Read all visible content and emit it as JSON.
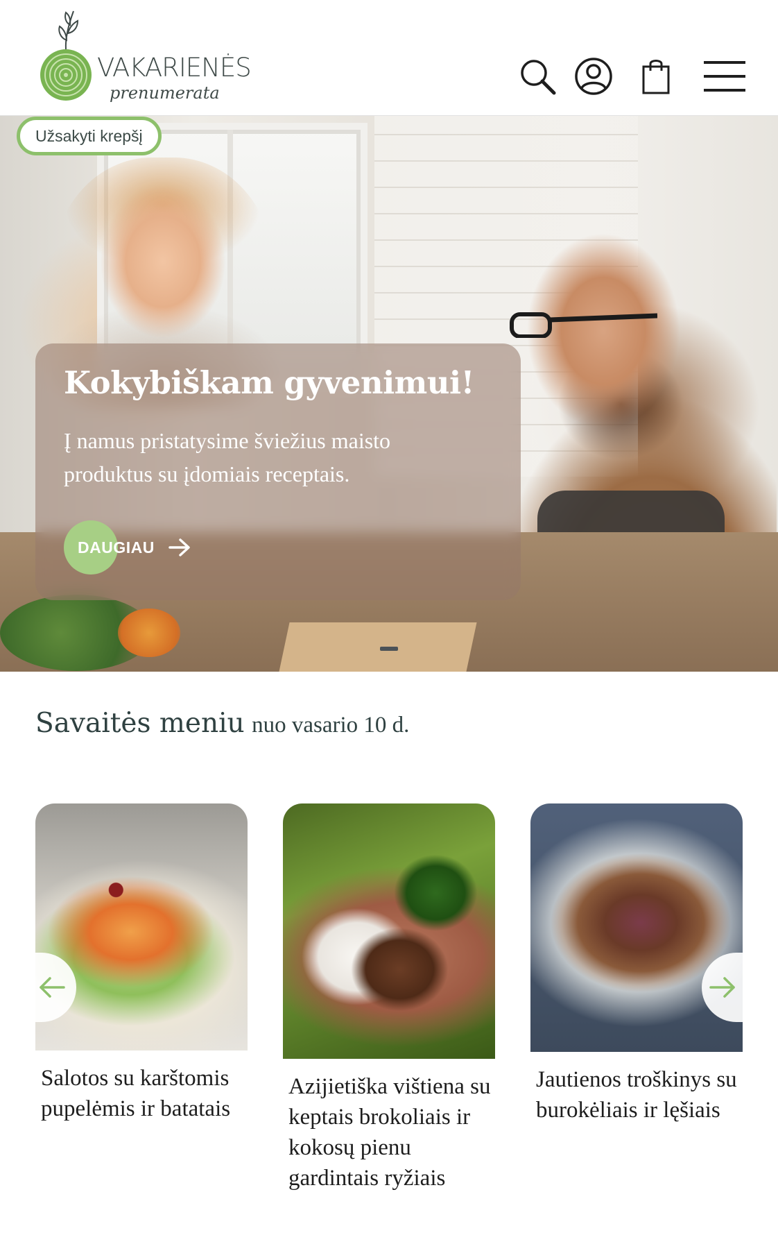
{
  "brand": {
    "name": "VAKARIENĖS",
    "sub": "prenumerata",
    "colors": {
      "green": "#8dc06b",
      "button_green": "#a7cf85",
      "dark_text": "#2f4141"
    }
  },
  "header": {
    "icons": [
      "search-icon",
      "user-icon",
      "shopping-bag-icon",
      "hamburger-menu-icon"
    ]
  },
  "hero": {
    "order_badge": "Užsakyti krepšį",
    "title": "Kokybiškam gyvenimui!",
    "text": "Į namus pristatysime šviežius maisto produktus su įdomiais receptais.",
    "button_label": "DAUGIAU"
  },
  "menu": {
    "title": "Savaitės meniu",
    "subtitle": "nuo vasario 10 d.",
    "dishes": [
      {
        "name": "Salotos su karštomis pupelėmis ir batatais"
      },
      {
        "name": "Azijietiška vištiena su keptais brokoliais ir kokosų pienu gardintais ryžiais"
      },
      {
        "name": "Jautienos troškinys su burokėliais ir lęšiais"
      }
    ]
  }
}
